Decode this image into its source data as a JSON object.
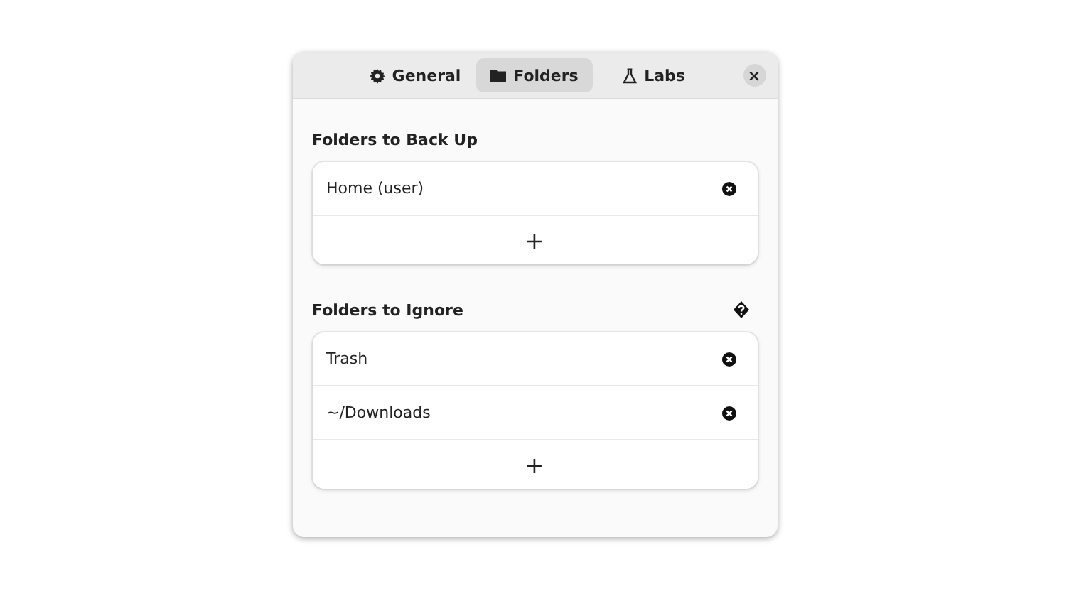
{
  "tabs": [
    {
      "label": "General",
      "kind": "gear",
      "selected": false
    },
    {
      "label": "Folders",
      "kind": "folder",
      "selected": true
    },
    {
      "label": "Labs",
      "kind": "flask",
      "selected": false
    }
  ],
  "close_button": {
    "label": "×"
  },
  "sections": [
    {
      "title": "Folders to Back Up",
      "items": [
        {
          "label": "Home (user)"
        }
      ],
      "add_label": "+"
    },
    {
      "title": "Folders to Ignore",
      "help_icon": true,
      "items": [
        {
          "label": "Trash"
        },
        {
          "label": "~/Downloads"
        }
      ],
      "add_label": "+"
    }
  ]
}
